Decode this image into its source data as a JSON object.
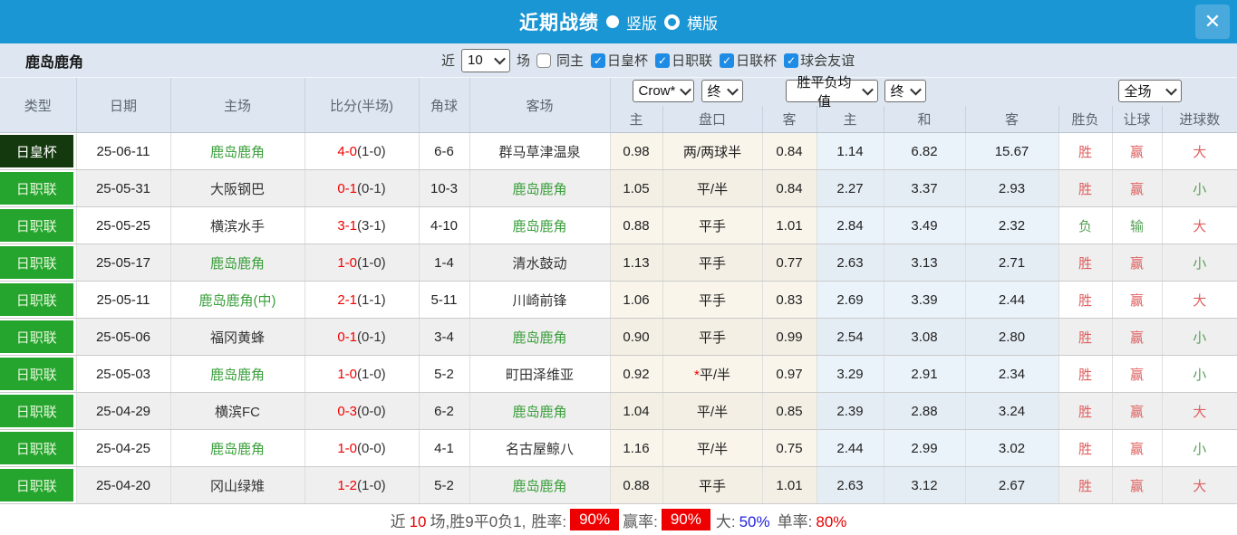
{
  "titlebar": {
    "title": "近期战绩",
    "radio_vertical_label": "竖版",
    "radio_horizontal_label": "横版",
    "radio_selected": "竖版",
    "close_glyph": "✕"
  },
  "filter": {
    "team": "鹿岛鹿角",
    "near_label": "近",
    "count_value": "10",
    "games_label": "场",
    "same_home_label": "同主",
    "same_home_checked": false,
    "leagues": [
      {
        "label": "日皇杯",
        "checked": true
      },
      {
        "label": "日职联",
        "checked": true
      },
      {
        "label": "日联杯",
        "checked": true
      },
      {
        "label": "球会友谊",
        "checked": true
      }
    ],
    "check_glyph": "✓"
  },
  "selects": {
    "company": "Crow*",
    "final1": "终",
    "avg": "胜平负均值",
    "final2": "终",
    "full_match": "全场"
  },
  "table": {
    "headers": {
      "type": "类型",
      "date": "日期",
      "home": "主场",
      "score": "比分(半场)",
      "corner": "角球",
      "away": "客场",
      "odds_home": "主",
      "handicap": "盘口",
      "odds_away": "客",
      "avg_home": "主",
      "avg_draw": "和",
      "avg_away": "客",
      "result_wl": "胜负",
      "result_handicap": "让球",
      "result_goals": "进球数"
    },
    "rows": [
      {
        "type": "日皇杯",
        "type_style": "type-cup",
        "date": "25-06-11",
        "home": {
          "text": "鹿岛鹿角",
          "highlight": true
        },
        "score_ft": "4-0",
        "score_ht": "(1-0)",
        "corner": "6-6",
        "away": {
          "text": "群马草津温泉",
          "highlight": false
        },
        "handicap_odds_home": "0.98",
        "handicap": "两/两球半",
        "handicap_star": false,
        "handicap_odds_away": "0.84",
        "avg_home": "1.14",
        "avg_draw": "6.82",
        "avg_away": "15.67",
        "result_wl": {
          "text": "胜",
          "color": "red"
        },
        "result_handicap": {
          "text": "赢",
          "color": "red"
        },
        "result_goals": {
          "text": "大",
          "color": "red"
        }
      },
      {
        "type": "日职联",
        "type_style": "type-league",
        "date": "25-05-31",
        "home": {
          "text": "大阪钢巴",
          "highlight": false
        },
        "score_ft": "0-1",
        "score_ht": "(0-1)",
        "corner": "10-3",
        "away": {
          "text": "鹿岛鹿角",
          "highlight": true
        },
        "handicap_odds_home": "1.05",
        "handicap": "平/半",
        "handicap_star": false,
        "handicap_odds_away": "0.84",
        "avg_home": "2.27",
        "avg_draw": "3.37",
        "avg_away": "2.93",
        "result_wl": {
          "text": "胜",
          "color": "red"
        },
        "result_handicap": {
          "text": "赢",
          "color": "red"
        },
        "result_goals": {
          "text": "小",
          "color": "green"
        }
      },
      {
        "type": "日职联",
        "type_style": "type-league",
        "date": "25-05-25",
        "home": {
          "text": "横滨水手",
          "highlight": false
        },
        "score_ft": "3-1",
        "score_ht": "(3-1)",
        "corner": "4-10",
        "away": {
          "text": "鹿岛鹿角",
          "highlight": true
        },
        "handicap_odds_home": "0.88",
        "handicap": "平手",
        "handicap_star": false,
        "handicap_odds_away": "1.01",
        "avg_home": "2.84",
        "avg_draw": "3.49",
        "avg_away": "2.32",
        "result_wl": {
          "text": "负",
          "color": "green"
        },
        "result_handicap": {
          "text": "输",
          "color": "green"
        },
        "result_goals": {
          "text": "大",
          "color": "red"
        }
      },
      {
        "type": "日职联",
        "type_style": "type-league",
        "date": "25-05-17",
        "home": {
          "text": "鹿岛鹿角",
          "highlight": true
        },
        "score_ft": "1-0",
        "score_ht": "(1-0)",
        "corner": "1-4",
        "away": {
          "text": "清水鼓动",
          "highlight": false
        },
        "handicap_odds_home": "1.13",
        "handicap": "平手",
        "handicap_star": false,
        "handicap_odds_away": "0.77",
        "avg_home": "2.63",
        "avg_draw": "3.13",
        "avg_away": "2.71",
        "result_wl": {
          "text": "胜",
          "color": "red"
        },
        "result_handicap": {
          "text": "赢",
          "color": "red"
        },
        "result_goals": {
          "text": "小",
          "color": "green"
        }
      },
      {
        "type": "日职联",
        "type_style": "type-league",
        "date": "25-05-11",
        "home": {
          "text": "鹿岛鹿角(中)",
          "highlight": true
        },
        "score_ft": "2-1",
        "score_ht": "(1-1)",
        "corner": "5-11",
        "away": {
          "text": "川崎前锋",
          "highlight": false
        },
        "handicap_odds_home": "1.06",
        "handicap": "平手",
        "handicap_star": false,
        "handicap_odds_away": "0.83",
        "avg_home": "2.69",
        "avg_draw": "3.39",
        "avg_away": "2.44",
        "result_wl": {
          "text": "胜",
          "color": "red"
        },
        "result_handicap": {
          "text": "赢",
          "color": "red"
        },
        "result_goals": {
          "text": "大",
          "color": "red"
        }
      },
      {
        "type": "日职联",
        "type_style": "type-league",
        "date": "25-05-06",
        "home": {
          "text": "福冈黄蜂",
          "highlight": false
        },
        "score_ft": "0-1",
        "score_ht": "(0-1)",
        "corner": "3-4",
        "away": {
          "text": "鹿岛鹿角",
          "highlight": true
        },
        "handicap_odds_home": "0.90",
        "handicap": "平手",
        "handicap_star": false,
        "handicap_odds_away": "0.99",
        "avg_home": "2.54",
        "avg_draw": "3.08",
        "avg_away": "2.80",
        "result_wl": {
          "text": "胜",
          "color": "red"
        },
        "result_handicap": {
          "text": "赢",
          "color": "red"
        },
        "result_goals": {
          "text": "小",
          "color": "green"
        }
      },
      {
        "type": "日职联",
        "type_style": "type-league",
        "date": "25-05-03",
        "home": {
          "text": "鹿岛鹿角",
          "highlight": true
        },
        "score_ft": "1-0",
        "score_ht": "(1-0)",
        "corner": "5-2",
        "away": {
          "text": "町田泽维亚",
          "highlight": false
        },
        "handicap_odds_home": "0.92",
        "handicap": "平/半",
        "handicap_star": true,
        "handicap_odds_away": "0.97",
        "avg_home": "3.29",
        "avg_draw": "2.91",
        "avg_away": "2.34",
        "result_wl": {
          "text": "胜",
          "color": "red"
        },
        "result_handicap": {
          "text": "赢",
          "color": "red"
        },
        "result_goals": {
          "text": "小",
          "color": "green"
        }
      },
      {
        "type": "日职联",
        "type_style": "type-league",
        "date": "25-04-29",
        "home": {
          "text": "横滨FC",
          "highlight": false
        },
        "score_ft": "0-3",
        "score_ht": "(0-0)",
        "corner": "6-2",
        "away": {
          "text": "鹿岛鹿角",
          "highlight": true
        },
        "handicap_odds_home": "1.04",
        "handicap": "平/半",
        "handicap_star": false,
        "handicap_odds_away": "0.85",
        "avg_home": "2.39",
        "avg_draw": "2.88",
        "avg_away": "3.24",
        "result_wl": {
          "text": "胜",
          "color": "red"
        },
        "result_handicap": {
          "text": "赢",
          "color": "red"
        },
        "result_goals": {
          "text": "大",
          "color": "red"
        }
      },
      {
        "type": "日职联",
        "type_style": "type-league",
        "date": "25-04-25",
        "home": {
          "text": "鹿岛鹿角",
          "highlight": true
        },
        "score_ft": "1-0",
        "score_ht": "(0-0)",
        "corner": "4-1",
        "away": {
          "text": "名古屋鲸八",
          "highlight": false
        },
        "handicap_odds_home": "1.16",
        "handicap": "平/半",
        "handicap_star": false,
        "handicap_odds_away": "0.75",
        "avg_home": "2.44",
        "avg_draw": "2.99",
        "avg_away": "3.02",
        "result_wl": {
          "text": "胜",
          "color": "red"
        },
        "result_handicap": {
          "text": "赢",
          "color": "red"
        },
        "result_goals": {
          "text": "小",
          "color": "green"
        }
      },
      {
        "type": "日职联",
        "type_style": "type-league",
        "date": "25-04-20",
        "home": {
          "text": "冈山绿雉",
          "highlight": false
        },
        "score_ft": "1-2",
        "score_ht": "(1-0)",
        "corner": "5-2",
        "away": {
          "text": "鹿岛鹿角",
          "highlight": true
        },
        "handicap_odds_home": "0.88",
        "handicap": "平手",
        "handicap_star": false,
        "handicap_odds_away": "1.01",
        "avg_home": "2.63",
        "avg_draw": "3.12",
        "avg_away": "2.67",
        "result_wl": {
          "text": "胜",
          "color": "red"
        },
        "result_handicap": {
          "text": "赢",
          "color": "red"
        },
        "result_goals": {
          "text": "大",
          "color": "red"
        }
      }
    ]
  },
  "summary": {
    "near_label": "近",
    "near_count": "10",
    "record_text": "场,胜9平0负1,",
    "win_rate_label": "胜率:",
    "win_rate": "90%",
    "handicap_rate_label": "赢率:",
    "handicap_rate": "90%",
    "big_label": "大:",
    "big_rate": "50%",
    "single_label": "单率:",
    "single_rate": "80%"
  },
  "colors": {
    "titlebar_blue": "#1b96d4",
    "header_bg": "#dee7f1",
    "cup_green": "#15390f",
    "league_green": "#25a42e",
    "score_red": "#f20000",
    "result_red": "#df5f5f",
    "result_green": "#55a055",
    "team_green": "#3ba03c",
    "badge_red": "#ee0000",
    "rate_blue": "#2222dd"
  }
}
